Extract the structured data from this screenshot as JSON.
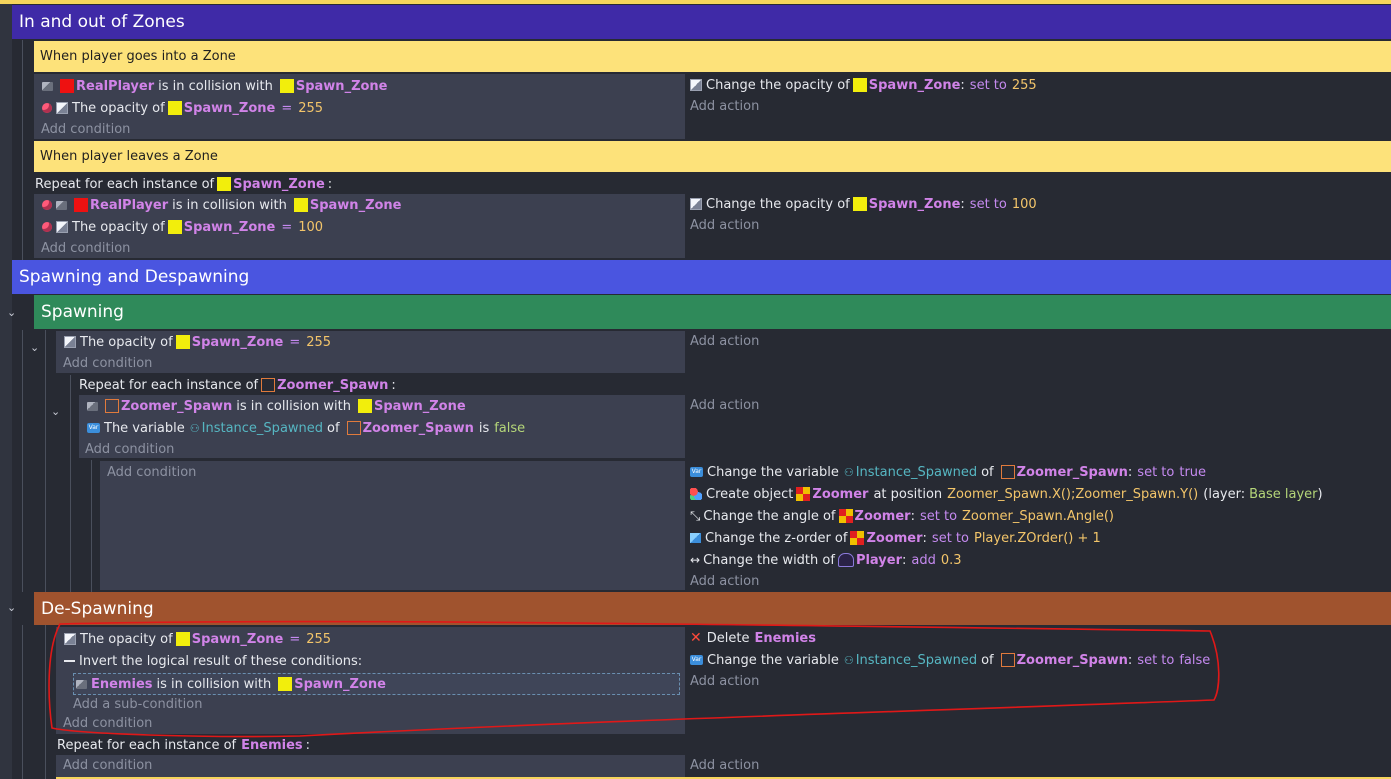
{
  "colors": {
    "background": "#272a33",
    "group_purple": "#3f2aa7",
    "group_blue": "#4a55e0",
    "group_green": "#2f8a5a",
    "group_orange": "#a0532e",
    "comment_yellow": "#fde27a",
    "condition_bg": "#3c4050",
    "annotation_red": "#e01818"
  },
  "groups": {
    "in_out": "In and out of Zones",
    "spawning_despawning": "Spawning and Despawning",
    "spawning": "Spawning",
    "despawning": "De-Spawning"
  },
  "comments": {
    "goes_into": "When player goes into a Zone",
    "leaves": "When player leaves a Zone"
  },
  "common": {
    "add_condition": "Add condition",
    "add_action": "Add action",
    "add_subcondition": "Add a sub-condition",
    "is_in_collision_with": "is in collision with",
    "the_opacity_of": "The opacity of",
    "change_opacity_of": "Change the opacity of",
    "set_to": "set to",
    "eq": "=",
    "repeat_prefix": "Repeat for each instance of",
    "colon": ":",
    "the_variable": "The variable",
    "of": "of",
    "is": "is",
    "change_the_variable": "Change the variable",
    "create_object": "Create object",
    "at_position": "at position",
    "layer_prefix": "(layer:",
    "layer_suffix": ")",
    "change_angle_of": "Change the angle of",
    "change_zorder_of": "Change the z-order of",
    "change_width_of": "Change the width of",
    "add_word": "add",
    "invert": "Invert the logical result of these conditions:",
    "delete": "Delete"
  },
  "objects": {
    "real_player": "RealPlayer",
    "spawn_zone": "Spawn_Zone",
    "zoomer_spawn": "Zoomer_Spawn",
    "zoomer": "Zoomer",
    "player": "Player",
    "enemies": "Enemies",
    "instance_spawned": "Instance_Spawned"
  },
  "values": {
    "v255": "255",
    "v100": "100",
    "false": "false",
    "true": "true",
    "position_expr": "Zoomer_Spawn.X();Zoomer_Spawn.Y()",
    "layer_name": "Base layer",
    "angle_expr": "Zoomer_Spawn.Angle()",
    "zorder_expr": "Player.ZOrder() + 1",
    "width_value": "0.3"
  }
}
